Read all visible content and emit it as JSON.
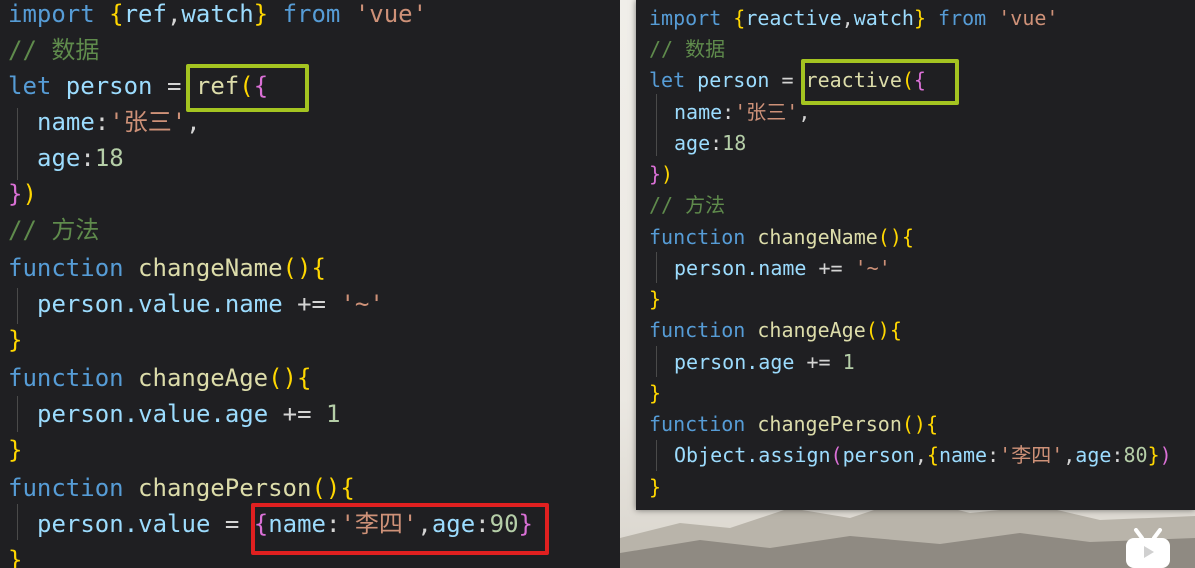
{
  "left": {
    "lines": [
      [
        "import",
        " {",
        "ref",
        ",",
        "watch",
        "}",
        " from",
        " 'vue'"
      ],
      [
        "// 数据"
      ],
      [
        "let",
        " person",
        " = ",
        "ref",
        "(",
        "{"
      ],
      [
        "name",
        ":",
        "'张三'",
        ","
      ],
      [
        "age",
        ":",
        "18"
      ],
      [
        "}",
        ")"
      ],
      [
        "// 方法"
      ],
      [
        "function",
        " changeName",
        "(){"
      ],
      [
        "person.value.name",
        " += ",
        "'~'"
      ],
      [
        "}"
      ],
      [
        "function",
        " changeAge",
        "(){"
      ],
      [
        "person.value.age",
        " += ",
        "1"
      ],
      [
        "}"
      ],
      [
        "function",
        " changePerson",
        "(){"
      ],
      [
        "person.value",
        " = ",
        "{",
        "name",
        ":",
        "'李四'",
        ",",
        "age",
        ":",
        "90",
        "}"
      ],
      [
        "}"
      ]
    ]
  },
  "right": {
    "lines": [
      [
        "import",
        " {",
        "reactive",
        ",",
        "watch",
        "}",
        " from",
        " 'vue'"
      ],
      [
        "// 数据"
      ],
      [
        "let",
        " person",
        " = ",
        "reactive",
        "(",
        "{"
      ],
      [
        "name",
        ":",
        "'张三'",
        ","
      ],
      [
        "age",
        ":",
        "18"
      ],
      [
        "}",
        ")"
      ],
      [
        "// 方法"
      ],
      [
        "function",
        " changeName",
        "(){"
      ],
      [
        "person.name",
        " += ",
        "'~'"
      ],
      [
        "}"
      ],
      [
        "function",
        " changeAge",
        "(){"
      ],
      [
        "person.age",
        " += ",
        "1"
      ],
      [
        "}"
      ],
      [
        "function",
        " changePerson",
        "(){"
      ],
      [
        "Object.assign",
        "(",
        "person",
        ",",
        "{",
        "name",
        ":",
        "'李四'",
        ",",
        "age",
        ":",
        "80",
        "}",
        ")"
      ],
      [
        "}"
      ]
    ]
  },
  "colors": {
    "highlight_green": "#a4c421",
    "highlight_red": "#e02020",
    "editor_bg": "#1f1f22"
  },
  "icons": {
    "bilibili": "bilibili-tv-icon"
  }
}
